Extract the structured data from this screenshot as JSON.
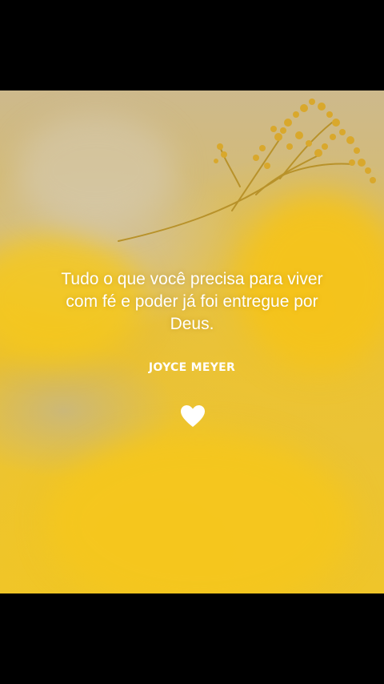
{
  "quote": {
    "text": "Tudo o que você precisa para viver com fé e poder já foi entregue por Deus.",
    "author": "JOYCE MEYER"
  },
  "icons": {
    "heart": "heart-icon"
  },
  "colors": {
    "background": "#000000",
    "text": "#ffffff",
    "accent_yellow": "#efc52a"
  }
}
